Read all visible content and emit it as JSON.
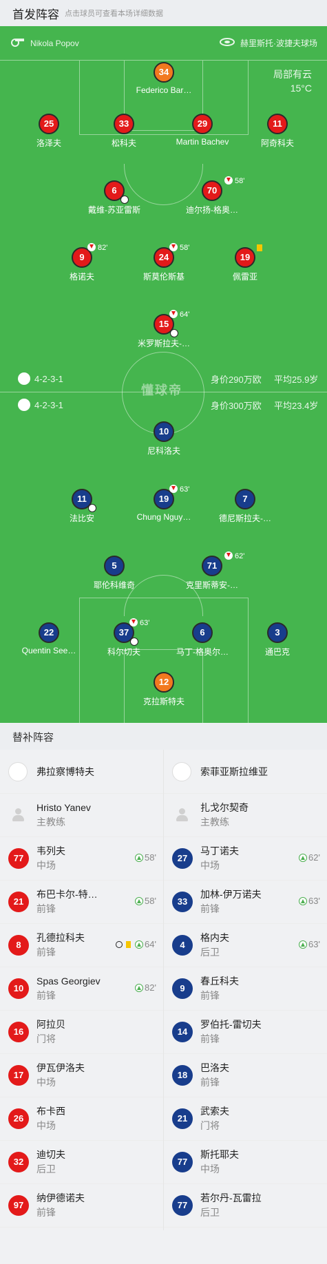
{
  "header": {
    "title": "首发阵容",
    "subtitle": "点击球员可查看本场详细数据"
  },
  "match": {
    "referee": "Nikola Popov",
    "venue": "赫里斯托·波捷夫球场",
    "weather": "局部有云",
    "temperature": "15°C"
  },
  "watermark": "懂球帝",
  "home_team": {
    "formation": "4-2-3-1",
    "value": "身价290万欧",
    "avg_age": "平均25.9岁",
    "players": [
      {
        "num": "34",
        "name": "Federico Bar…",
        "gk": true
      },
      {
        "num": "25",
        "name": "洛泽夫"
      },
      {
        "num": "33",
        "name": "松科夫"
      },
      {
        "num": "29",
        "name": "Martin Bachev"
      },
      {
        "num": "11",
        "name": "阿奇科夫"
      },
      {
        "num": "6",
        "name": "戴维-苏亚雷斯"
      },
      {
        "num": "70",
        "name": "迪尔扬-格奥…",
        "sub": "58'"
      },
      {
        "num": "9",
        "name": "格诺夫",
        "sub": "82'"
      },
      {
        "num": "24",
        "name": "斯莫伦斯基",
        "sub": "58'"
      },
      {
        "num": "19",
        "name": "佩雷亚"
      },
      {
        "num": "15",
        "name": "米罗斯拉夫-…",
        "sub": "64'"
      }
    ]
  },
  "away_team": {
    "formation": "4-2-3-1",
    "value": "身价300万欧",
    "avg_age": "平均23.4岁",
    "players": [
      {
        "num": "10",
        "name": "尼科洛夫"
      },
      {
        "num": "11",
        "name": "法比安"
      },
      {
        "num": "19",
        "name": "Chung Nguy…",
        "sub": "63'"
      },
      {
        "num": "7",
        "name": "德尼斯拉夫-…"
      },
      {
        "num": "5",
        "name": "耶伦科维奇"
      },
      {
        "num": "71",
        "name": "克里斯蒂安-…",
        "sub": "62'"
      },
      {
        "num": "22",
        "name": "Quentin See…"
      },
      {
        "num": "37",
        "name": "科尔切夫",
        "sub": "63'"
      },
      {
        "num": "6",
        "name": "马丁-格奥尔…"
      },
      {
        "num": "3",
        "name": "通巴克"
      },
      {
        "num": "12",
        "name": "克拉斯特夫",
        "gk": true
      }
    ]
  },
  "subs": {
    "title": "替补阵容",
    "home": {
      "team": "弗拉察博特夫",
      "coach": {
        "name": "Hristo Yanev",
        "role": "主教练"
      },
      "players": [
        {
          "num": "77",
          "name": "韦列夫",
          "pos": "中场",
          "min": "58'"
        },
        {
          "num": "21",
          "name": "布巴卡尔-特…",
          "pos": "前锋",
          "min": "58'"
        },
        {
          "num": "8",
          "name": "孔德拉科夫",
          "pos": "前锋",
          "min": "64'"
        },
        {
          "num": "10",
          "name": "Spas Georgiev",
          "pos": "前锋",
          "min": "82'"
        },
        {
          "num": "16",
          "name": "阿拉贝",
          "pos": "门将"
        },
        {
          "num": "17",
          "name": "伊瓦伊洛夫",
          "pos": "中场"
        },
        {
          "num": "26",
          "name": "布卡西",
          "pos": "中场"
        },
        {
          "num": "32",
          "name": "迪切夫",
          "pos": "后卫"
        },
        {
          "num": "97",
          "name": "纳伊德诺夫",
          "pos": "前锋"
        }
      ]
    },
    "away": {
      "team": "索菲亚斯拉维亚",
      "coach": {
        "name": "扎戈尔契奇",
        "role": "主教练"
      },
      "players": [
        {
          "num": "27",
          "name": "马丁诺夫",
          "pos": "中场",
          "min": "62'"
        },
        {
          "num": "33",
          "name": "加林-伊万诺夫",
          "pos": "前锋",
          "min": "63'"
        },
        {
          "num": "4",
          "name": "格内夫",
          "pos": "后卫",
          "min": "63'"
        },
        {
          "num": "9",
          "name": "春丘科夫",
          "pos": "前锋"
        },
        {
          "num": "14",
          "name": "罗伯托-雷切夫",
          "pos": "前锋"
        },
        {
          "num": "18",
          "name": "巴洛夫",
          "pos": "前锋"
        },
        {
          "num": "21",
          "name": "武索夫",
          "pos": "门将"
        },
        {
          "num": "77",
          "name": "斯托耶夫",
          "pos": "中场"
        },
        {
          "num": "77",
          "name": "若尔丹-瓦雷拉",
          "pos": "后卫"
        }
      ]
    }
  },
  "colors": {
    "pitch": "#45b54e",
    "home": "#e31a1a",
    "away": "#183d8c",
    "gk": "#f2791f"
  }
}
